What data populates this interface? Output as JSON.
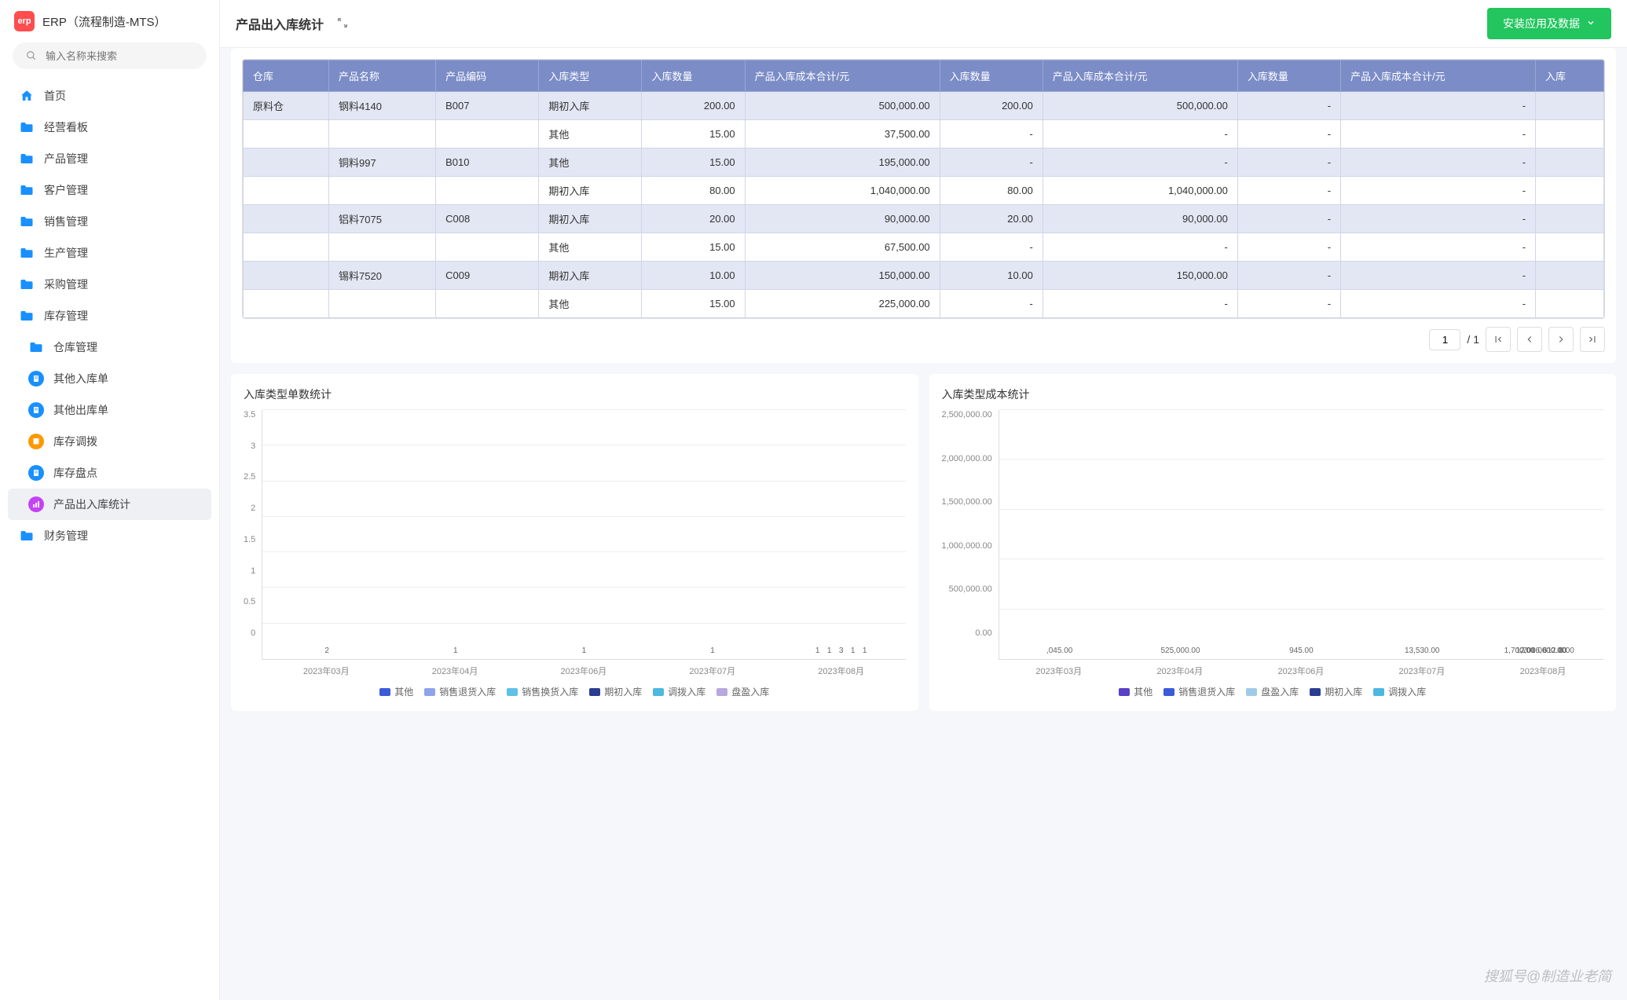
{
  "app_title": "ERP（流程制造-MTS）",
  "search_placeholder": "输入名称来搜索",
  "page_title": "产品出入库统计",
  "install_btn": "安装应用及数据",
  "watermark": "搜狐号@制造业老简",
  "nav": [
    {
      "label": "首页",
      "icon": "home"
    },
    {
      "label": "经营看板",
      "icon": "folder"
    },
    {
      "label": "产品管理",
      "icon": "folder"
    },
    {
      "label": "客户管理",
      "icon": "folder"
    },
    {
      "label": "销售管理",
      "icon": "folder"
    },
    {
      "label": "生产管理",
      "icon": "folder"
    },
    {
      "label": "采购管理",
      "icon": "folder"
    },
    {
      "label": "库存管理",
      "icon": "folder",
      "expanded": true,
      "children": [
        {
          "label": "仓库管理",
          "icon": "folder"
        },
        {
          "label": "其他入库单",
          "icon": "doc"
        },
        {
          "label": "其他出库单",
          "icon": "doc"
        },
        {
          "label": "库存调拨",
          "icon": "box"
        },
        {
          "label": "库存盘点",
          "icon": "doc"
        },
        {
          "label": "产品出入库统计",
          "icon": "chart",
          "active": true
        }
      ]
    },
    {
      "label": "财务管理",
      "icon": "folder"
    }
  ],
  "table": {
    "headers": [
      "仓库",
      "产品名称",
      "产品编码",
      "入库类型",
      "入库数量",
      "产品入库成本合计/元",
      "入库数量",
      "产品入库成本合计/元",
      "入库数量",
      "产品入库成本合计/元",
      "入库"
    ],
    "rows": [
      [
        "原料仓",
        "钢料4140",
        "B007",
        "期初入库",
        "200.00",
        "500,000.00",
        "200.00",
        "500,000.00",
        "-",
        "-",
        ""
      ],
      [
        "",
        "",
        "",
        "其他",
        "15.00",
        "37,500.00",
        "-",
        "-",
        "-",
        "-",
        ""
      ],
      [
        "",
        "铜料997",
        "B010",
        "其他",
        "15.00",
        "195,000.00",
        "-",
        "-",
        "-",
        "-",
        ""
      ],
      [
        "",
        "",
        "",
        "期初入库",
        "80.00",
        "1,040,000.00",
        "80.00",
        "1,040,000.00",
        "-",
        "-",
        ""
      ],
      [
        "",
        "铝料7075",
        "C008",
        "期初入库",
        "20.00",
        "90,000.00",
        "20.00",
        "90,000.00",
        "-",
        "-",
        ""
      ],
      [
        "",
        "",
        "",
        "其他",
        "15.00",
        "67,500.00",
        "-",
        "-",
        "-",
        "-",
        ""
      ],
      [
        "",
        "锡料7520",
        "C009",
        "期初入库",
        "10.00",
        "150,000.00",
        "10.00",
        "150,000.00",
        "-",
        "-",
        ""
      ],
      [
        "",
        "",
        "",
        "其他",
        "15.00",
        "225,000.00",
        "-",
        "-",
        "-",
        "-",
        ""
      ]
    ],
    "page_current": "1",
    "page_total": "/ 1"
  },
  "chart_data": [
    {
      "title": "入库类型单数统计",
      "type": "bar",
      "categories": [
        "2023年03月",
        "2023年04月",
        "2023年06月",
        "2023年07月",
        "2023年08月"
      ],
      "series_names": [
        "其他",
        "销售退货入库",
        "销售换货入库",
        "期初入库",
        "调拨入库",
        "盘盈入库"
      ],
      "colors": [
        "#3b5bd9",
        "#8ea4ea",
        "#60c0e8",
        "#2a3e8f",
        "#4db8e0",
        "#b9a8e0"
      ],
      "ylim": [
        0,
        3.5
      ],
      "ticks": [
        "0",
        "0.5",
        "1",
        "1.5",
        "2",
        "2.5",
        "3",
        "3.5"
      ],
      "data": [
        {
          "cat": 0,
          "series": 0,
          "value": 2,
          "label": "2"
        },
        {
          "cat": 1,
          "series": 0,
          "value": 1,
          "label": "1"
        },
        {
          "cat": 2,
          "series": 2,
          "value": 1,
          "label": "1"
        },
        {
          "cat": 3,
          "series": 5,
          "value": 1,
          "label": "1"
        },
        {
          "cat": 4,
          "series": 0,
          "value": 1,
          "label": "1"
        },
        {
          "cat": 4,
          "series": 1,
          "value": 1,
          "label": "1"
        },
        {
          "cat": 4,
          "series": 3,
          "value": 3,
          "label": "3"
        },
        {
          "cat": 4,
          "series": 4,
          "value": 1,
          "label": "1"
        },
        {
          "cat": 4,
          "series": 5,
          "value": 1,
          "label": "1"
        }
      ]
    },
    {
      "title": "入库类型成本统计",
      "type": "bar",
      "categories": [
        "2023年03月",
        "2023年04月",
        "2023年06月",
        "2023年07月",
        "2023年08月"
      ],
      "series_names": [
        "其他",
        "销售退货入库",
        "盘盈入库",
        "期初入库",
        "调拨入库"
      ],
      "colors": [
        "#5b3fc4",
        "#3b5bd9",
        "#9fcbe8",
        "#2a3e8f",
        "#4db8e0"
      ],
      "ylim": [
        0,
        2500000
      ],
      "ticks": [
        "0.00",
        "500,000.00",
        "1,000,000.00",
        "1,500,000.00",
        "2,000,000.00",
        "2,500,000.00"
      ],
      "data": [
        {
          "cat": 0,
          "series": 0,
          "value": 45000,
          "label": ",045.00"
        },
        {
          "cat": 1,
          "series": 0,
          "value": 525000,
          "label": "525,000.00"
        },
        {
          "cat": 2,
          "series": 0,
          "value": 945,
          "label": "945.00"
        },
        {
          "cat": 3,
          "series": 0,
          "value": 13530,
          "label": "13,530.00"
        },
        {
          "cat": 4,
          "series": 1,
          "value": 1700,
          "label": "1,700.00"
        },
        {
          "cat": 4,
          "series": 2,
          "value": 1700,
          "label": "1,700.00"
        },
        {
          "cat": 4,
          "series": 3,
          "value": 2016600,
          "label": "2,016,600.00"
        },
        {
          "cat": 4,
          "series": 4,
          "value": 612007,
          "label": "612.00"
        },
        {
          "cat": 4,
          "series": 0,
          "value": 8000,
          "label": "8.00"
        }
      ]
    }
  ]
}
